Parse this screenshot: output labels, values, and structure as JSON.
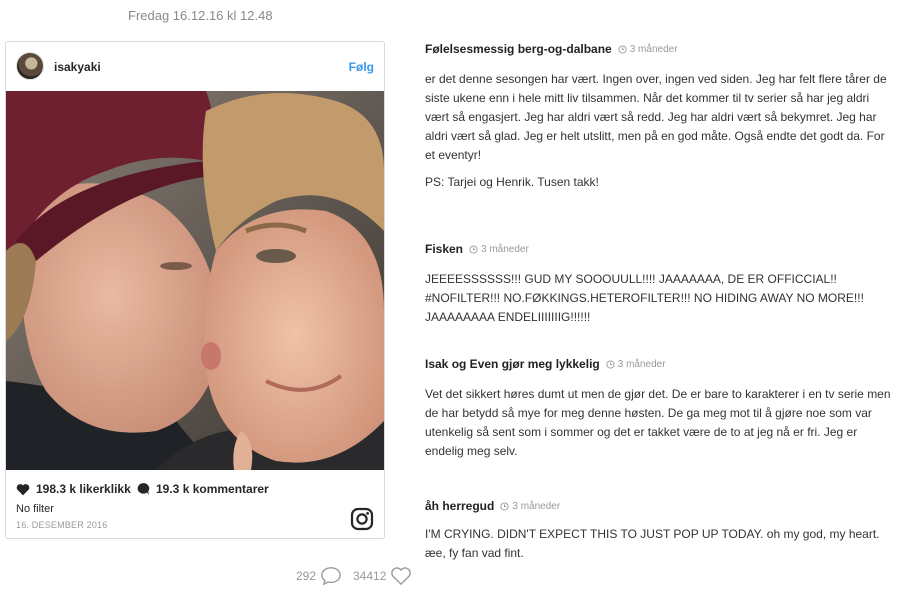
{
  "header": {
    "date": "Fredag 16.12.16 kl 12.48"
  },
  "instagram_card": {
    "username": "isakyaki",
    "follow_label": "Følg",
    "likes": "198.3 k likerklikk",
    "comments": "19.3 k kommentarer",
    "filter": "No filter",
    "post_date": "16. DESEMBER 2016"
  },
  "bottom_counts": {
    "comments": "292",
    "likes": "34412"
  },
  "comments": [
    {
      "author": "Følelsesmessig berg-og-dalbane",
      "time": "3 måneder",
      "paragraphs": [
        "er det denne sesongen har vært. Ingen over, ingen ved siden. Jeg har felt flere tårer de siste ukene enn i hele mitt liv tilsammen. Når det kommer til tv serier så har jeg aldri vært så engasjert. Jeg har aldri vært så redd. Jeg har aldri vært så bekymret. Jeg har aldri vært så glad. Jeg er helt utslitt, men på en god måte. Også endte det godt da. For et eventyr!",
        "PS: Tarjei og Henrik. Tusen takk!"
      ]
    },
    {
      "author": "Fisken",
      "time": "3 måneder",
      "paragraphs": [
        "JEEEESSSSSS!!! GUD MY SOOOUULL!!!! JAAAAAAA, DE ER OFFICCIAL!! #NOFILTER!!! NO.FØKKINGS.HETEROFILTER!!! NO HIDING AWAY NO MORE!!! JAAAAAAAA ENDELIIIIIIIG!!!!!!"
      ]
    },
    {
      "author": "Isak og Even gjør meg lykkelig",
      "time": "3 måneder",
      "paragraphs": [
        "Vet det sikkert høres dumt ut men de gjør det. De er bare to karakterer i en tv serie men de har betydd så mye for meg denne høsten. De ga meg mot til å gjøre noe som var utenkelig så sent som i sommer og det er takket være de to at jeg nå er fri. Jeg er endelig meg selv."
      ]
    },
    {
      "author": "åh herregud",
      "time": "3 måneder",
      "paragraphs": [
        "I'M CRYING. DIDN'T EXPECT THIS TO JUST POP UP TODAY. oh my god, my heart.",
        "æe, fy fan vad fint."
      ]
    }
  ],
  "icons": {
    "heart": "heart-icon",
    "speech": "speech-bubble-icon",
    "clock": "clock-icon",
    "instagram": "instagram-logo-icon"
  }
}
